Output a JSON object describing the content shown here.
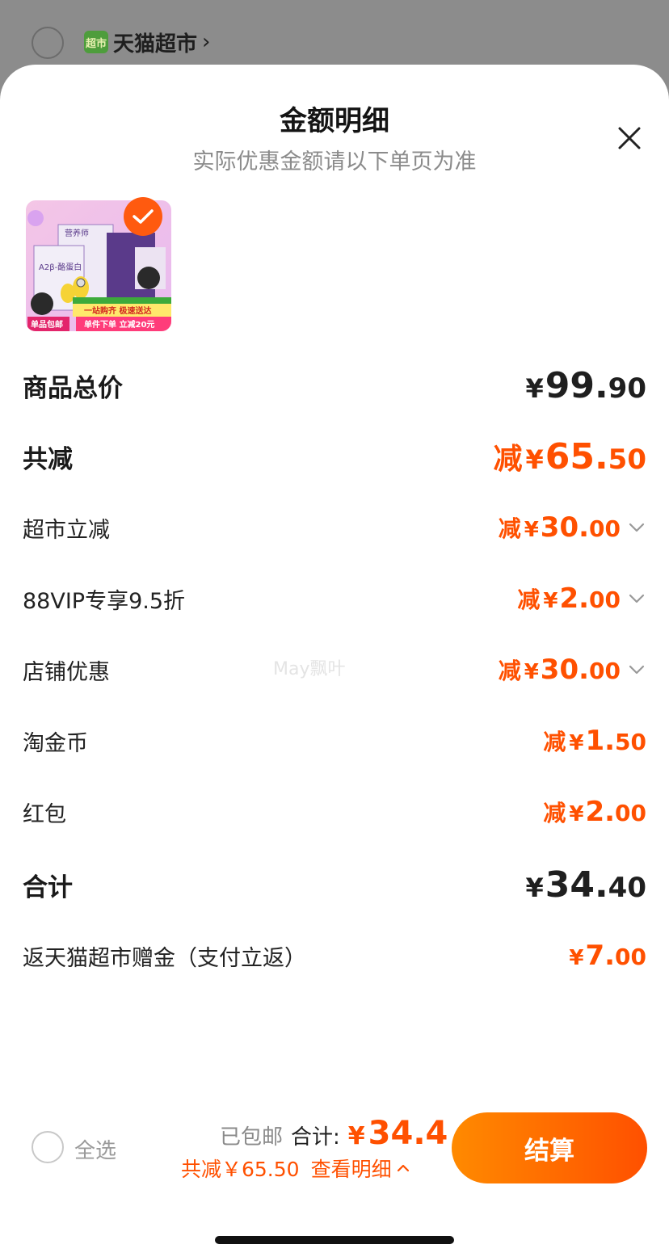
{
  "backdrop": {
    "store_badge": "超市",
    "store_name": "天猫超市",
    "store_chevron": "›"
  },
  "sheet": {
    "title": "金额明细",
    "subtitle": "实际优惠金额请以下单页为准",
    "close_icon": "close-icon"
  },
  "product": {
    "brand_text": "营养师",
    "product_text": "A2β-酪蛋白",
    "tag_free_shipping": "单品包邮",
    "banner_line1": "一站购齐 极速送达",
    "banner_line2": "单件下单 立减20元",
    "checked": true
  },
  "rows": [
    {
      "label": "商品总价",
      "reduce": "",
      "yen": "¥",
      "int": "99.",
      "dec": "90",
      "style": "total"
    },
    {
      "label": "共减",
      "reduce": "减",
      "yen": "¥",
      "int": "65.",
      "dec": "50",
      "style": "total-discount"
    },
    {
      "label": "超市立减",
      "reduce": "减",
      "yen": "¥",
      "int": "30.",
      "dec": "00",
      "expandable": true
    },
    {
      "label": "88VIP专享9.5折",
      "reduce": "减",
      "yen": "¥",
      "int": "2.",
      "dec": "00",
      "expandable": true
    },
    {
      "label": "店铺优惠",
      "reduce": "减",
      "yen": "¥",
      "int": "30.",
      "dec": "00",
      "expandable": true
    },
    {
      "label": "淘金币",
      "reduce": "减",
      "yen": "¥",
      "int": "1.",
      "dec": "50"
    },
    {
      "label": "红包",
      "reduce": "减",
      "yen": "¥",
      "int": "2.",
      "dec": "00"
    },
    {
      "label": "合计",
      "reduce": "",
      "yen": "¥",
      "int": "34.",
      "dec": "40",
      "style": "total"
    },
    {
      "label": "返天猫超市赠金（支付立返）",
      "reduce": "",
      "yen": "¥",
      "int": "7.",
      "dec": "00"
    }
  ],
  "watermark": "May飘叶",
  "bottom_bar": {
    "select_all": "全选",
    "shipped": "已包邮",
    "total_label": "合计:",
    "total_yen": "¥",
    "total_value": "34.4",
    "discount_text": "共减￥65.50",
    "detail_link": "查看明细",
    "checkout": "结算"
  },
  "colors": {
    "accent": "#ff5000",
    "accent_light": "#ff8a00"
  }
}
